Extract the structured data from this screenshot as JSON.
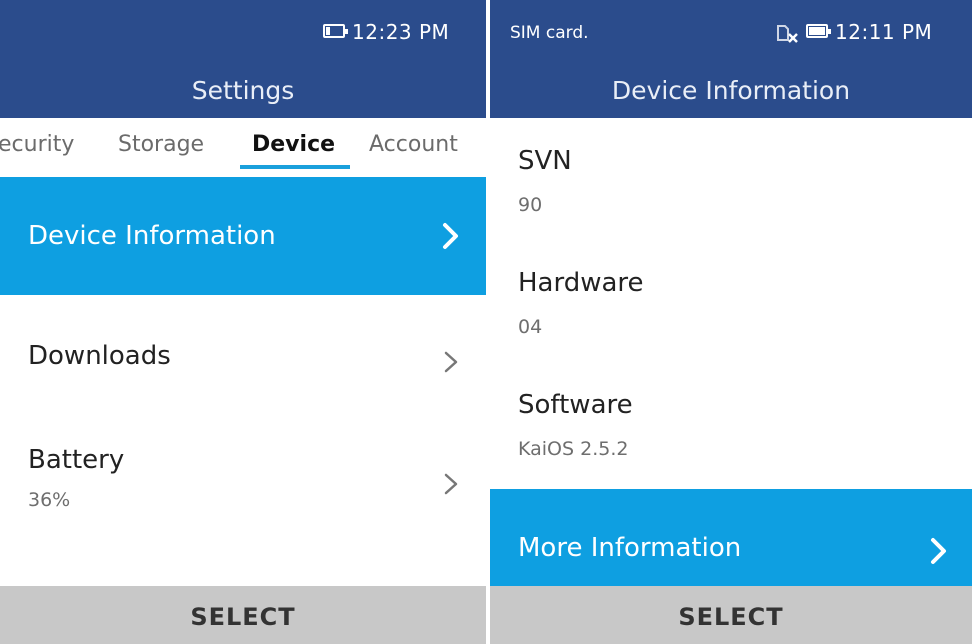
{
  "left": {
    "status": {
      "time": "12:23 PM"
    },
    "header": {
      "title": "Settings"
    },
    "tabs": [
      {
        "label": "ecurity"
      },
      {
        "label": "Storage"
      },
      {
        "label": "Device"
      },
      {
        "label": "Account"
      }
    ],
    "active_tab": "Device",
    "items": [
      {
        "label": "Device Information",
        "focused": true
      },
      {
        "label": "Downloads"
      },
      {
        "label": "Battery",
        "sub": "36%"
      }
    ],
    "softkey": {
      "center": "SELECT"
    }
  },
  "right": {
    "status": {
      "sim_text": "SIM card.",
      "time": "12:11 PM"
    },
    "header": {
      "title": "Device Information"
    },
    "fields": [
      {
        "label": "SVN",
        "value": "90"
      },
      {
        "label": "Hardware",
        "value": "04"
      },
      {
        "label": "Software",
        "value": "KaiOS 2.5.2"
      }
    ],
    "more_item": {
      "label": "More Information",
      "focused": true
    },
    "softkey": {
      "center": "SELECT"
    }
  },
  "icons": {
    "battery": "battery-icon",
    "no_sim": "no-sim-icon",
    "chevron": "chevron-right-icon"
  },
  "colors": {
    "header": "#2b4c8c",
    "focus": "#0e9fe1",
    "softkey_bar": "#c8c8c8",
    "tab_underline": "#1aa0dc"
  }
}
